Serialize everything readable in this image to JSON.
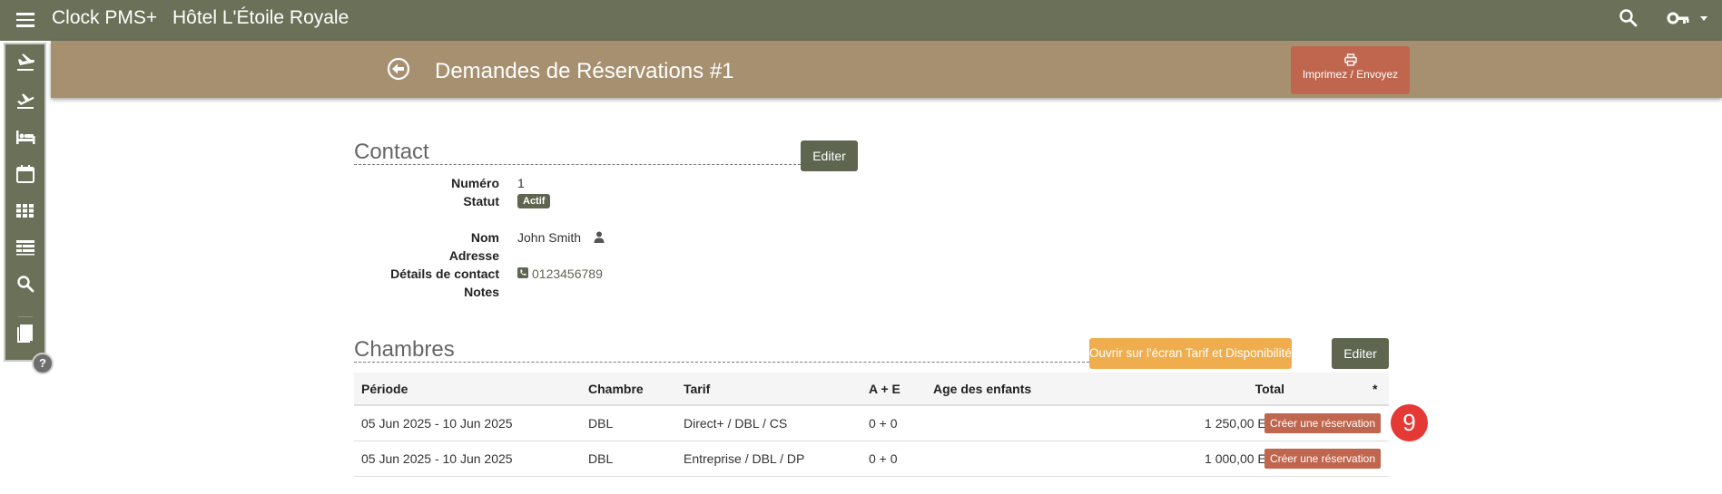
{
  "topbar": {
    "app_name": "Clock PMS+",
    "hotel_name": "Hôtel L'Étoile Royale",
    "icons": [
      "menu-icon",
      "search-icon",
      "key-icon",
      "caret-down-icon"
    ]
  },
  "header": {
    "title": "Demandes de Réservations #1",
    "print_label": "Imprimez / Envoyez"
  },
  "sidebar": {
    "icons": [
      "arrivals-icon",
      "departures-icon",
      "bed-icon",
      "calendar-icon",
      "grid-icon",
      "table-icon",
      "search-icon",
      "bookmark-icon"
    ],
    "help": "?"
  },
  "contact": {
    "title": "Contact",
    "edit_label": "Editer",
    "fields": {
      "numero_label": "Numéro",
      "numero": "1",
      "statut_label": "Statut",
      "statut": "Actif",
      "nom_label": "Nom",
      "nom": "John Smith",
      "adresse_label": "Adresse",
      "details_label": "Détails de contact",
      "phone": "0123456789",
      "notes_label": "Notes"
    }
  },
  "rooms": {
    "title": "Chambres",
    "open_label": "Ouvrir sur l'écran Tarif et Disponibilité",
    "edit_label": "Editer",
    "headers": {
      "periode": "Période",
      "chambre": "Chambre",
      "tarif": "Tarif",
      "ae": "A + E",
      "age": "Age des enfants",
      "total": "Total",
      "star": "*"
    },
    "rows": [
      {
        "periode": "05 Jun 2025 - 10 Jun 2025",
        "chambre": "DBL",
        "tarif": "Direct+ / DBL / CS",
        "ae": "0 + 0",
        "age": "",
        "total": "1 250,00 EUR",
        "action": "Créer une réservation"
      },
      {
        "periode": "05 Jun 2025 - 10 Jun 2025",
        "chambre": "DBL",
        "tarif": "Entreprise / DBL / DP",
        "ae": "0 + 0",
        "age": "",
        "total": "1 000,00 EUR",
        "action": "Créer une réservation"
      }
    ]
  },
  "marker": "9",
  "colors": {
    "topbar": "#6b7158",
    "header": "#a69070",
    "print_button": "#c0664e",
    "dark_button": "#5e6650",
    "orange_button": "#f0ad4e",
    "marker": "#e53935"
  }
}
